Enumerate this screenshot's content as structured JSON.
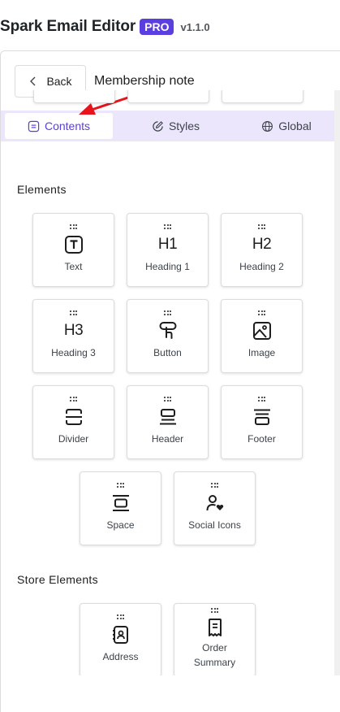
{
  "header": {
    "title": "Spark Email Editor",
    "badge": "PRO",
    "version": "v1.1.0"
  },
  "toolbar": {
    "back_label": "Back",
    "note_title": "Membership note"
  },
  "tabs": [
    {
      "label": "Contents",
      "icon": "list-square-icon",
      "active": true
    },
    {
      "label": "Styles",
      "icon": "pen-circle-icon",
      "active": false
    },
    {
      "label": "Global",
      "icon": "globe-icon",
      "active": false
    }
  ],
  "sections": {
    "elements_title": "Elements",
    "store_title": "Store Elements"
  },
  "elements": [
    {
      "label": "Text",
      "icon": "text-icon"
    },
    {
      "label": "Heading 1",
      "icon": "heading-1-icon",
      "glyph": "H1"
    },
    {
      "label": "Heading 2",
      "icon": "heading-2-icon",
      "glyph": "H2"
    },
    {
      "label": "Heading 3",
      "icon": "heading-3-icon",
      "glyph": "H3"
    },
    {
      "label": "Button",
      "icon": "button-click-icon"
    },
    {
      "label": "Image",
      "icon": "image-icon"
    },
    {
      "label": "Divider",
      "icon": "divider-icon"
    },
    {
      "label": "Header",
      "icon": "header-icon"
    },
    {
      "label": "Footer",
      "icon": "footer-icon"
    },
    {
      "label": "Space",
      "icon": "space-icon"
    },
    {
      "label": "Social Icons",
      "icon": "social-icon"
    }
  ],
  "store_elements": [
    {
      "label": "Address",
      "icon": "address-book-icon"
    },
    {
      "label_line1": "Order",
      "label_line2": "Summary",
      "icon": "receipt-icon"
    }
  ],
  "annotation": {
    "icon": "red-arrow-icon",
    "color": "#e8141c"
  },
  "colors": {
    "accent": "#5b3ee0",
    "tab_bar": "#ebe6fb"
  }
}
